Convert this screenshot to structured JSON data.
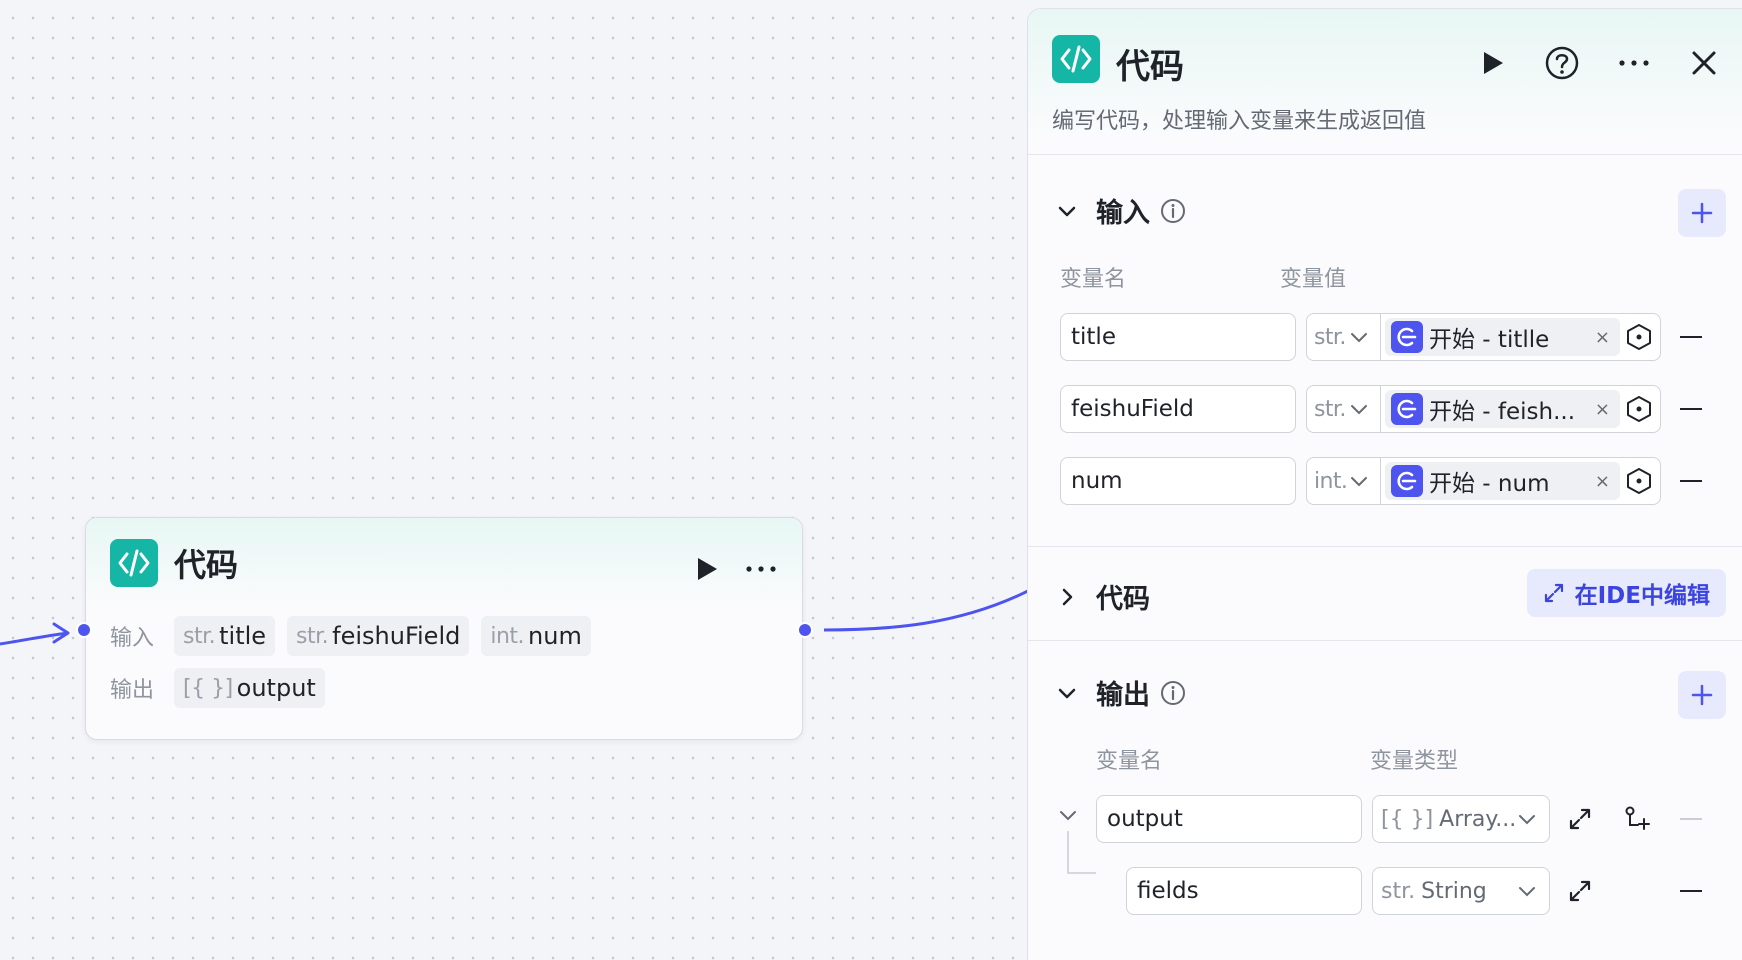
{
  "node": {
    "title": "代码",
    "input_label": "输入",
    "output_label": "输出",
    "inputs": [
      {
        "type": "str.",
        "name": "title"
      },
      {
        "type": "str.",
        "name": "feishuField"
      },
      {
        "type": "int.",
        "name": "num"
      }
    ],
    "outputs": [
      {
        "type": "[{ }]",
        "name": "output"
      }
    ]
  },
  "panel": {
    "title": "代码",
    "description": "编写代码，处理输入变量来生成返回值",
    "input_section": {
      "title": "输入",
      "col_name": "变量名",
      "col_value": "变量值",
      "rows": [
        {
          "name": "title",
          "type": "str.",
          "ref": "开始 - titlle"
        },
        {
          "name": "feishuField",
          "type": "str.",
          "ref": "开始 - feish..."
        },
        {
          "name": "num",
          "type": "int.",
          "ref": "开始 - num"
        }
      ]
    },
    "code_section": {
      "title": "代码",
      "ide_button": "在IDE中编辑"
    },
    "output_section": {
      "title": "输出",
      "col_name": "变量名",
      "col_type": "变量类型",
      "rows": [
        {
          "name": "output",
          "type_icon": "[{ }]",
          "type": "Array...",
          "is_parent": true
        },
        {
          "name": "fields",
          "type_icon": "str.",
          "type": "String",
          "is_parent": false
        }
      ]
    }
  },
  "colors": {
    "accent": "#4e55ee",
    "code_badge": "#16b6a6",
    "ide_button_bg": "#e7eafd",
    "ide_button_text": "#3c44de"
  },
  "icons": {
    "node_icon": "code-brackets-icon",
    "ref_icon": "start-node-ref-icon"
  }
}
